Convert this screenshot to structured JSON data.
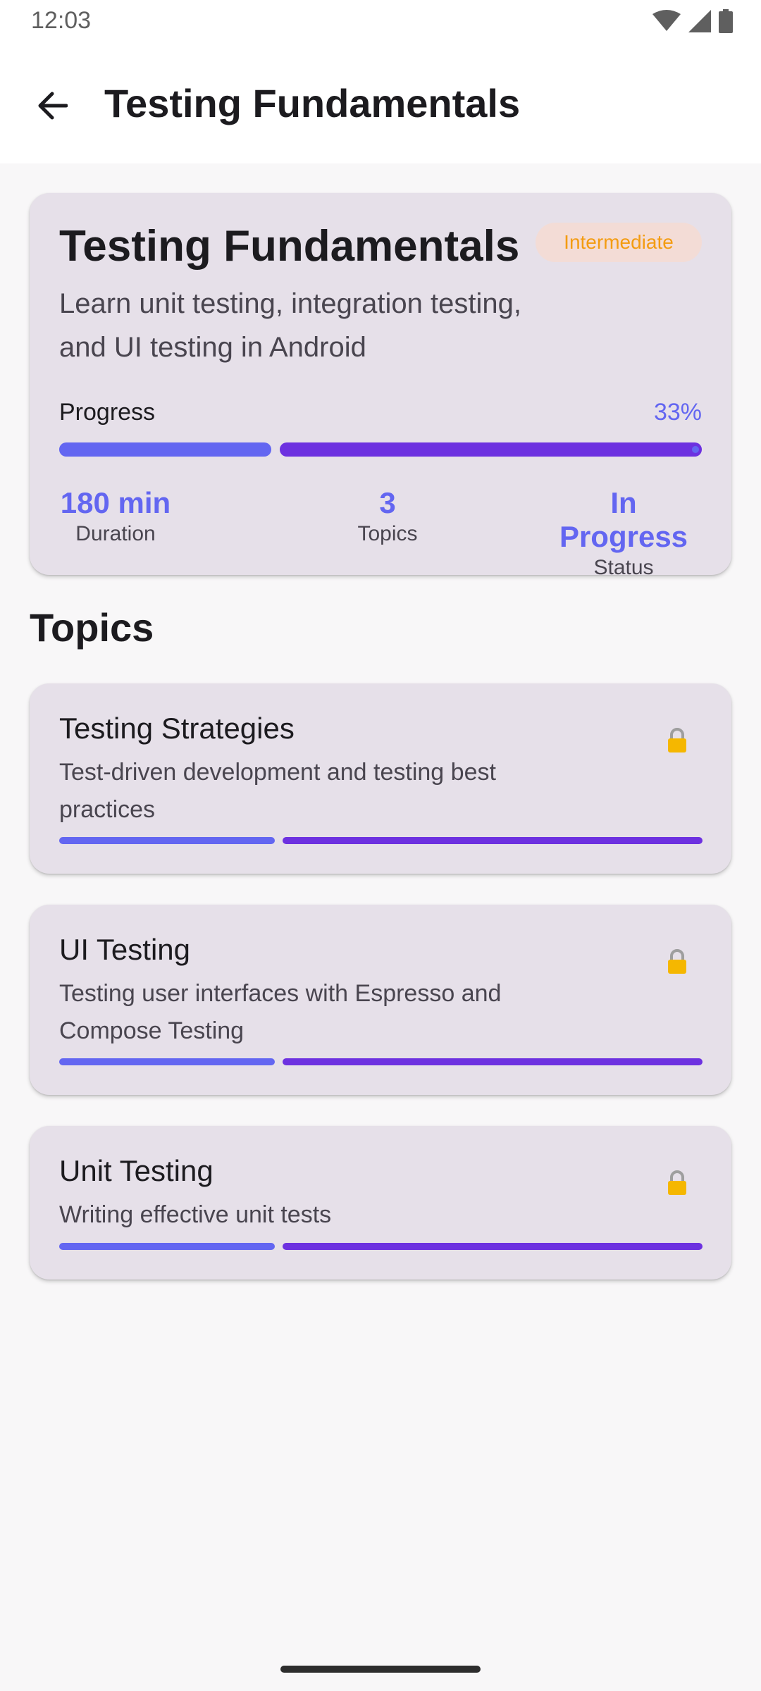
{
  "status_bar": {
    "time": "12:03",
    "icons": [
      "wifi-icon",
      "signal-icon",
      "battery-icon"
    ]
  },
  "app_bar": {
    "back_icon": "arrow-back-icon",
    "title": "Testing Fundamentals"
  },
  "course": {
    "title": "Testing Fundamentals",
    "level": "Intermediate",
    "description": "Learn unit testing, integration testing, and UI testing in Android",
    "progress_label": "Progress",
    "progress_text": "33%",
    "progress_fraction": 0.33,
    "stats": [
      {
        "value": "180 min",
        "label": "Duration"
      },
      {
        "value": "3",
        "label": "Topics"
      },
      {
        "value": "In Progress",
        "label": "Status"
      }
    ]
  },
  "topics_heading": "Topics",
  "topics": [
    {
      "title": "Testing Strategies",
      "description": "Test-driven development and testing best practices",
      "icon": "lock-icon"
    },
    {
      "title": "UI Testing",
      "description": "Testing user interfaces with Espresso and Compose Testing",
      "icon": "lock-icon"
    },
    {
      "title": "Unit Testing",
      "description": "Writing effective unit tests",
      "icon": "lock-icon"
    }
  ],
  "colors": {
    "accent": "#6366f1",
    "track": "#6d31e0",
    "badge_text": "#f39c12",
    "badge_bg": "#f3dcd6",
    "card": "#e6e0e9",
    "background": "#f8f7f8"
  }
}
